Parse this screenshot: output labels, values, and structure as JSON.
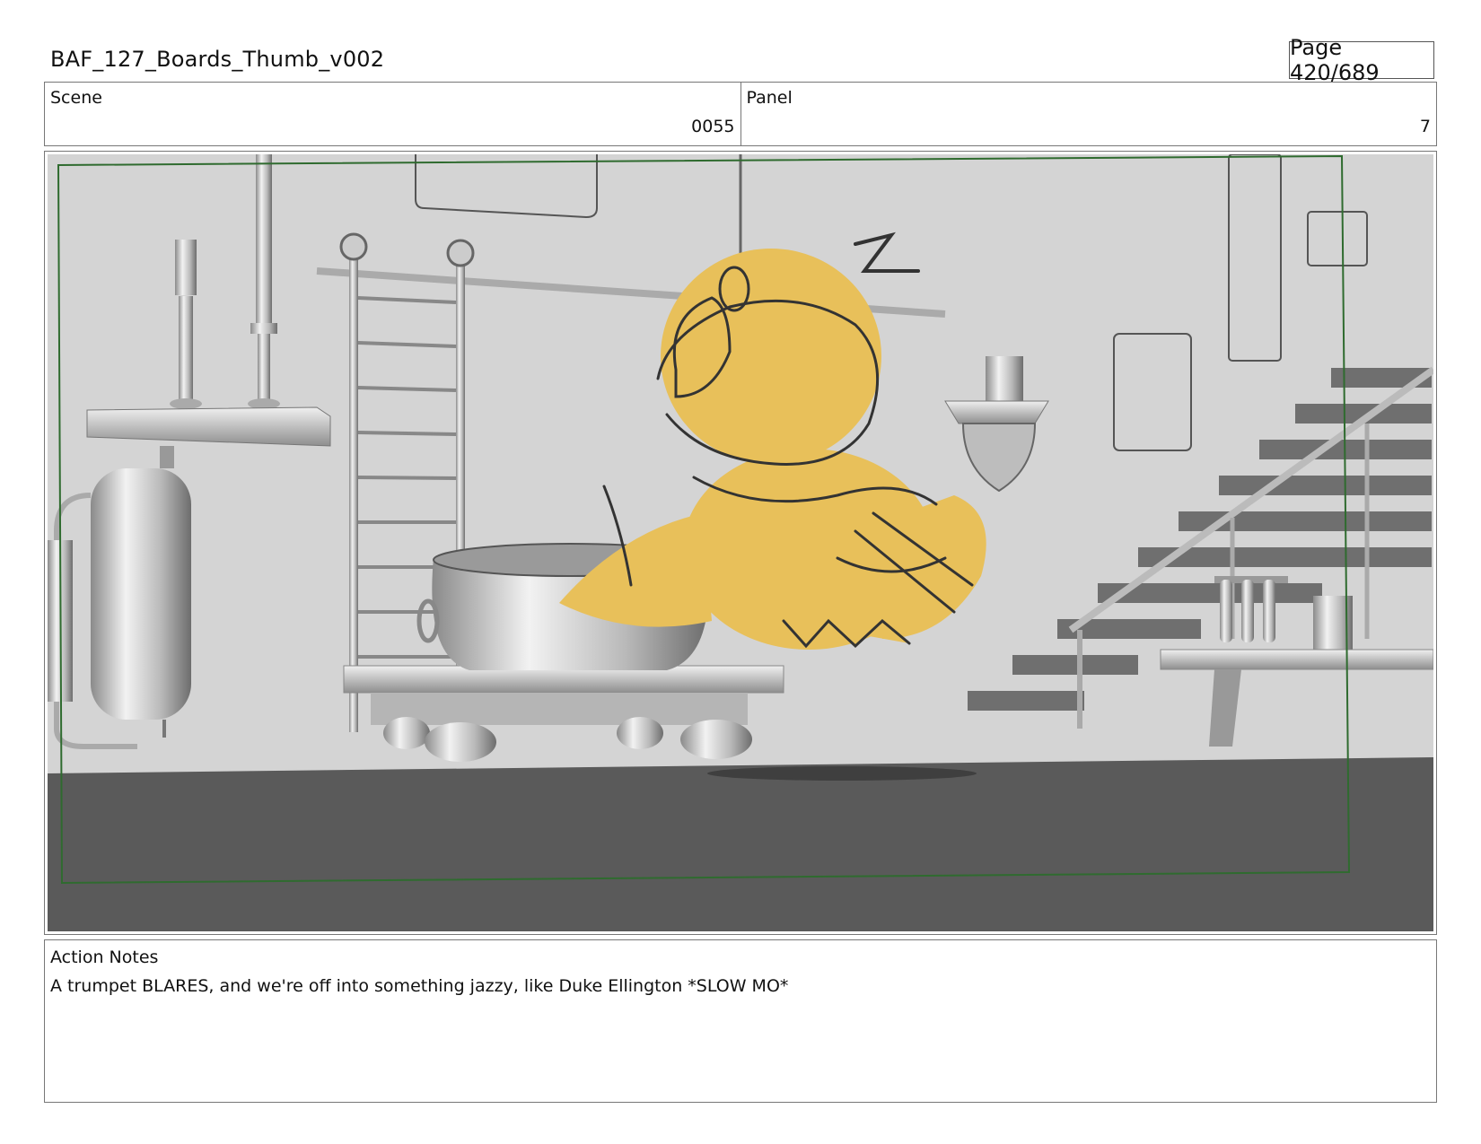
{
  "header": {
    "title": "BAF_127_Boards_Thumb_v002",
    "page": "Page 420/689"
  },
  "info": {
    "scene_label": "Scene",
    "scene_value": "0055",
    "panel_label": "Panel",
    "panel_value": "7"
  },
  "notes": {
    "label": "Action Notes",
    "text": "A trumpet BLARES, and we're off into something jazzy, like Duke Ellington *SLOW MO*"
  },
  "colors": {
    "bird": "#e8c05a",
    "safe_frame": "#2f6b2f",
    "floor": "#5a5a5a",
    "wall": "#d4d4d4"
  }
}
